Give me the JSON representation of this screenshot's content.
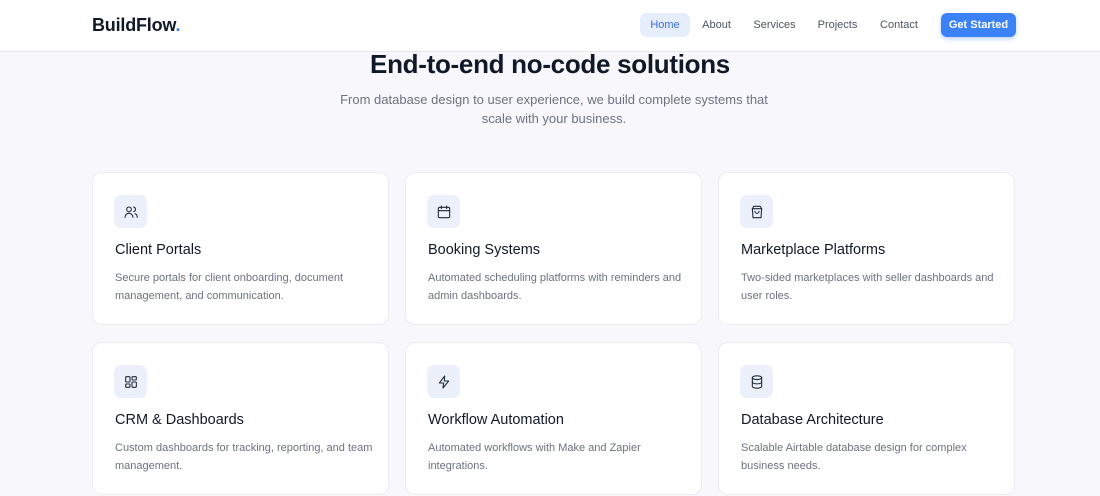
{
  "brand": {
    "name": "BuildFlow",
    "dot": ".",
    "accent": "#3b82f6"
  },
  "nav": {
    "items": [
      {
        "label": "Home",
        "active": true
      },
      {
        "label": "About"
      },
      {
        "label": "Services"
      },
      {
        "label": "Projects"
      },
      {
        "label": "Contact"
      }
    ],
    "cta_label": "Get Started"
  },
  "hero": {
    "title": "End-to-end no-code solutions",
    "subtitle": "From database design to user experience, we build complete systems that scale with your business."
  },
  "services": [
    {
      "icon": "users-icon",
      "title": "Client Portals",
      "description": "Secure portals for client onboarding, document management, and communication."
    },
    {
      "icon": "calendar-icon",
      "title": "Booking Systems",
      "description": "Automated scheduling platforms with reminders and admin dashboards."
    },
    {
      "icon": "shopping-bag-icon",
      "title": "Marketplace Platforms",
      "description": "Two-sided marketplaces with seller dashboards and user roles."
    },
    {
      "icon": "dashboard-icon",
      "title": "CRM & Dashboards",
      "description": "Custom dashboards for tracking, reporting, and team management."
    },
    {
      "icon": "lightning-icon",
      "title": "Workflow Automation",
      "description": "Automated workflows with Make and Zapier integrations."
    },
    {
      "icon": "database-icon",
      "title": "Database Architecture",
      "description": "Scalable Airtable database design for complex business needs."
    }
  ]
}
